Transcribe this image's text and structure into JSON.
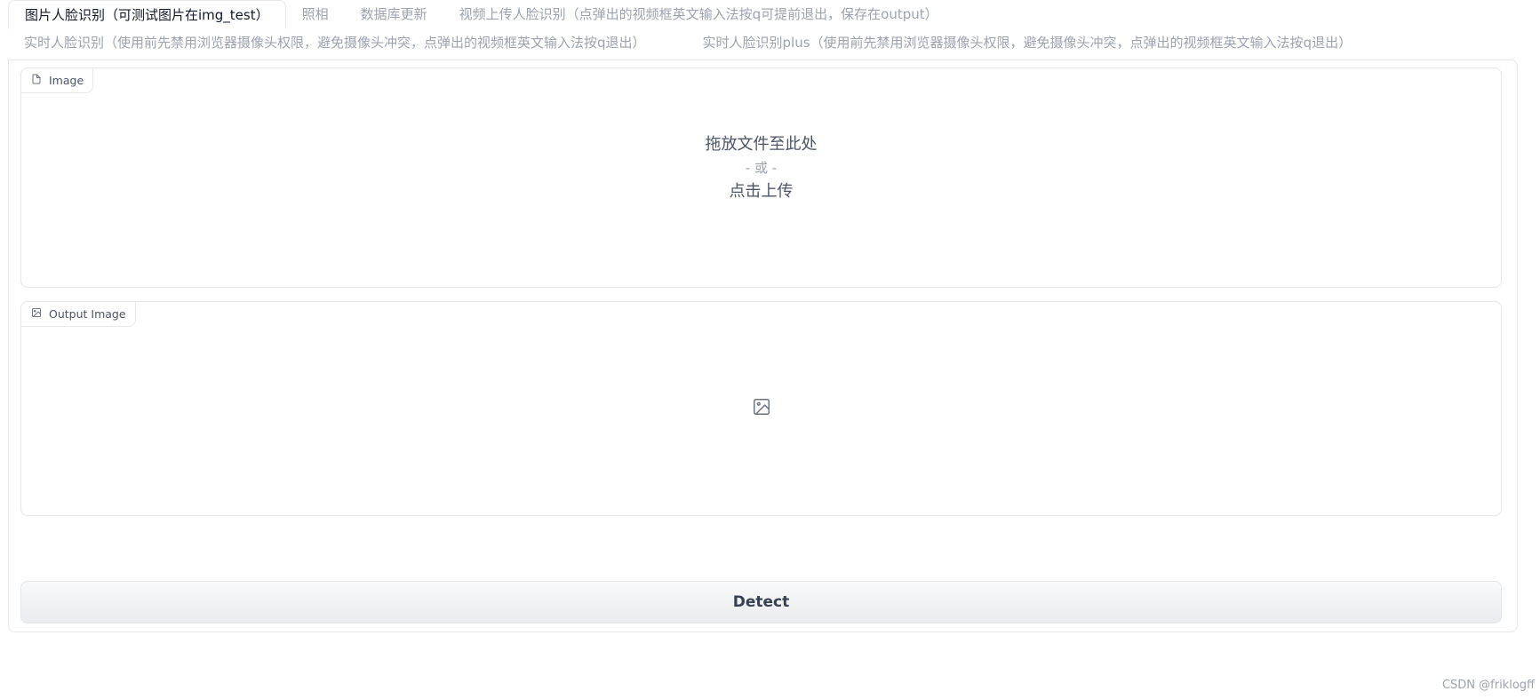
{
  "tabs": [
    {
      "label": "图片人脸识别（可测试图片在img_test）",
      "selected": true
    },
    {
      "label": "照相",
      "selected": false
    },
    {
      "label": "数据库更新",
      "selected": false
    },
    {
      "label": "视频上传人脸识别（点弹出的视频框英文输入法按q可提前退出，保存在output）",
      "selected": false
    },
    {
      "label": "实时人脸识别（使用前先禁用浏览器摄像头权限，避免摄像头冲突，点弹出的视频框英文输入法按q退出）",
      "selected": false
    },
    {
      "label": "实时人脸识别plus（使用前先禁用浏览器摄像头权限，避免摄像头冲突，点弹出的视频框英文输入法按q退出）",
      "selected": false
    }
  ],
  "image_input": {
    "label": "Image",
    "icon": "file-icon",
    "drop_text": "拖放文件至此处",
    "or_text": "- 或 -",
    "click_text": "点击上传"
  },
  "output_image": {
    "label": "Output Image",
    "icon": "image-icon",
    "placeholder_icon": "image-placeholder-icon"
  },
  "detect_button": {
    "label": "Detect"
  },
  "watermark": "CSDN @friklogff"
}
